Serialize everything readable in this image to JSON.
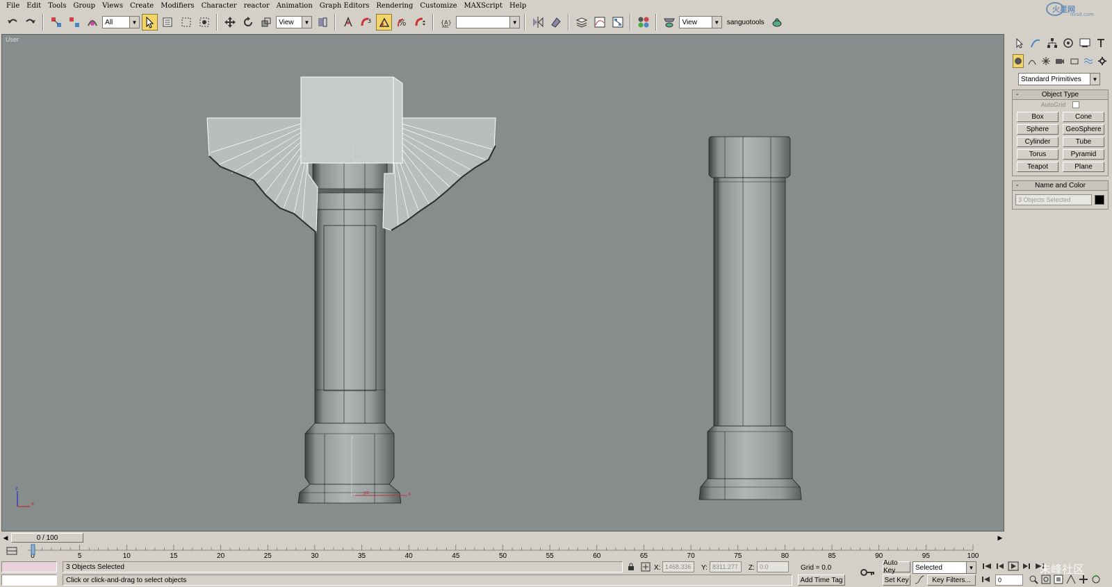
{
  "menu": [
    "File",
    "Edit",
    "Tools",
    "Group",
    "Views",
    "Create",
    "Modifiers",
    "Character",
    "reactor",
    "Animation",
    "Graph Editors",
    "Rendering",
    "Customize",
    "MAXScript",
    "Help"
  ],
  "brand": {
    "name": "火星网",
    "domain": "hxsd.com"
  },
  "toolbar": {
    "selection_filter": "All",
    "reference_coord": "View",
    "named_selection": "",
    "render_type": "View",
    "user_tool_label": "sanguotools",
    "icons": [
      "undo-icon",
      "redo-icon",
      "select-link-icon",
      "unlink-icon",
      "bind-space-warp-icon",
      "select-object-icon",
      "select-by-name-icon",
      "rect-selection-icon",
      "window-crossing-icon",
      "move-icon",
      "rotate-icon",
      "scale-icon",
      "pivot-icon",
      "mirror-icon",
      "align-icon",
      "layer-icon",
      "curve-editor-icon",
      "schematic-icon",
      "material-editor-icon",
      "render-scene-icon",
      "quick-render-icon"
    ]
  },
  "viewport": {
    "label": "User"
  },
  "command_panel": {
    "category": "Standard Primitives",
    "object_type_title": "Object Type",
    "autogrid_label": "AutoGrid",
    "buttons": [
      "Box",
      "Cone",
      "Sphere",
      "GeoSphere",
      "Cylinder",
      "Tube",
      "Torus",
      "Pyramid",
      "Teapot",
      "Plane"
    ],
    "name_color_title": "Name and Color",
    "name_value": "3 Objects Selected",
    "object_color": "#000000",
    "rollout_sign": "-"
  },
  "time_slider": {
    "value": "0 / 100",
    "current_frame": 0,
    "total_frames": 100
  },
  "trackbar": {
    "ticks": [
      0,
      5,
      10,
      15,
      20,
      25,
      30,
      35,
      40,
      45,
      50,
      55,
      60,
      65,
      70,
      75,
      80,
      85,
      90,
      95,
      100
    ]
  },
  "status": {
    "selection": "3 Objects Selected",
    "prompt": "Click or click-and-drag to select objects",
    "x_label": "X:",
    "x_value": "1468.336",
    "y_label": "Y:",
    "y_value": "8311.277",
    "z_label": "Z:",
    "z_value": "0.0",
    "grid": "Grid = 0.0",
    "add_time_tag": "Add Time Tag",
    "auto_key": "Auto Key",
    "set_key": "Set Key",
    "key_mode": "Selected",
    "key_filters": "Key Filters...",
    "frame": "0"
  },
  "watermark": "朱峰社区",
  "colors": {
    "ui_gray": "#d4d0c8",
    "viewport_bg": "#878d8d",
    "active_tool": "#f3d567",
    "selection_white": "#ffffff"
  }
}
